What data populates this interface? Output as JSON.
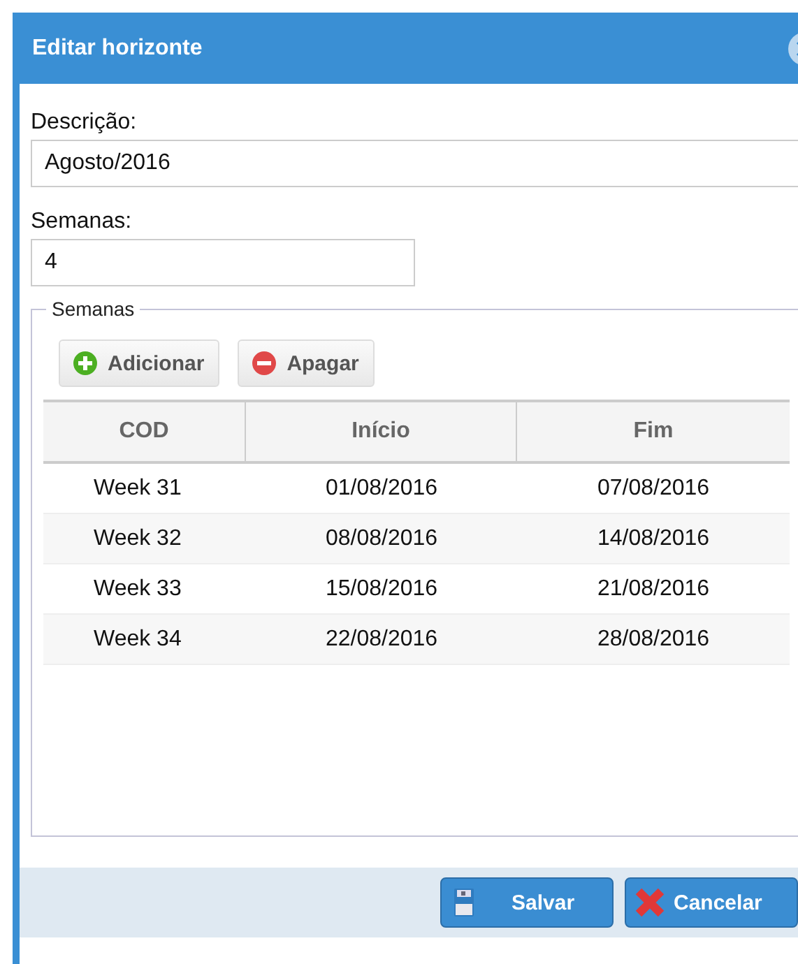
{
  "dialog": {
    "title": "Editar horizonte"
  },
  "fields": [
    {
      "label": "Descrição:",
      "value": "Agosto/2016",
      "kind": "wide"
    },
    {
      "label": "Semanas:",
      "value": "4",
      "kind": "short"
    }
  ],
  "weeks": {
    "legend": "Semanas",
    "toolbar": [
      {
        "label": "Adicionar",
        "kind": "add"
      },
      {
        "label": "Apagar",
        "kind": "delete"
      }
    ],
    "columns": [
      "COD",
      "Início",
      "Fim"
    ],
    "rows": [
      [
        "Week 31",
        "01/08/2016",
        "07/08/2016"
      ],
      [
        "Week 32",
        "08/08/2016",
        "14/08/2016"
      ],
      [
        "Week 33",
        "15/08/2016",
        "21/08/2016"
      ],
      [
        "Week 34",
        "22/08/2016",
        "28/08/2016"
      ]
    ]
  },
  "footer": [
    {
      "label": "Salvar",
      "kind": "save"
    },
    {
      "label": "Cancelar",
      "kind": "cancel"
    }
  ]
}
